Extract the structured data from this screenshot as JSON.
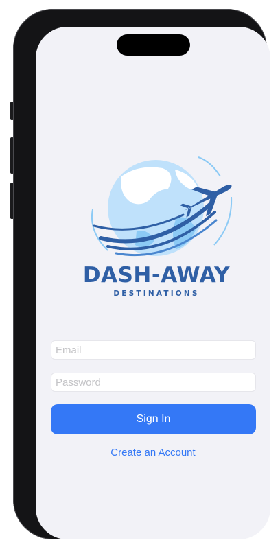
{
  "logo": {
    "wordmark": "DASH-AWAY",
    "tagline": "DESTINATIONS",
    "colors": {
      "dark_blue": "#2f5fa5",
      "light_blue": "#8ccaf5",
      "globe_ocean": "#bfe1fb"
    }
  },
  "login": {
    "email_placeholder": "Email",
    "password_placeholder": "Password",
    "sign_in_label": "Sign In",
    "create_account_label": "Create an Account"
  },
  "colors": {
    "accent": "#3478f6",
    "screen_background": "#f2f2f7",
    "frame": "#141416"
  }
}
